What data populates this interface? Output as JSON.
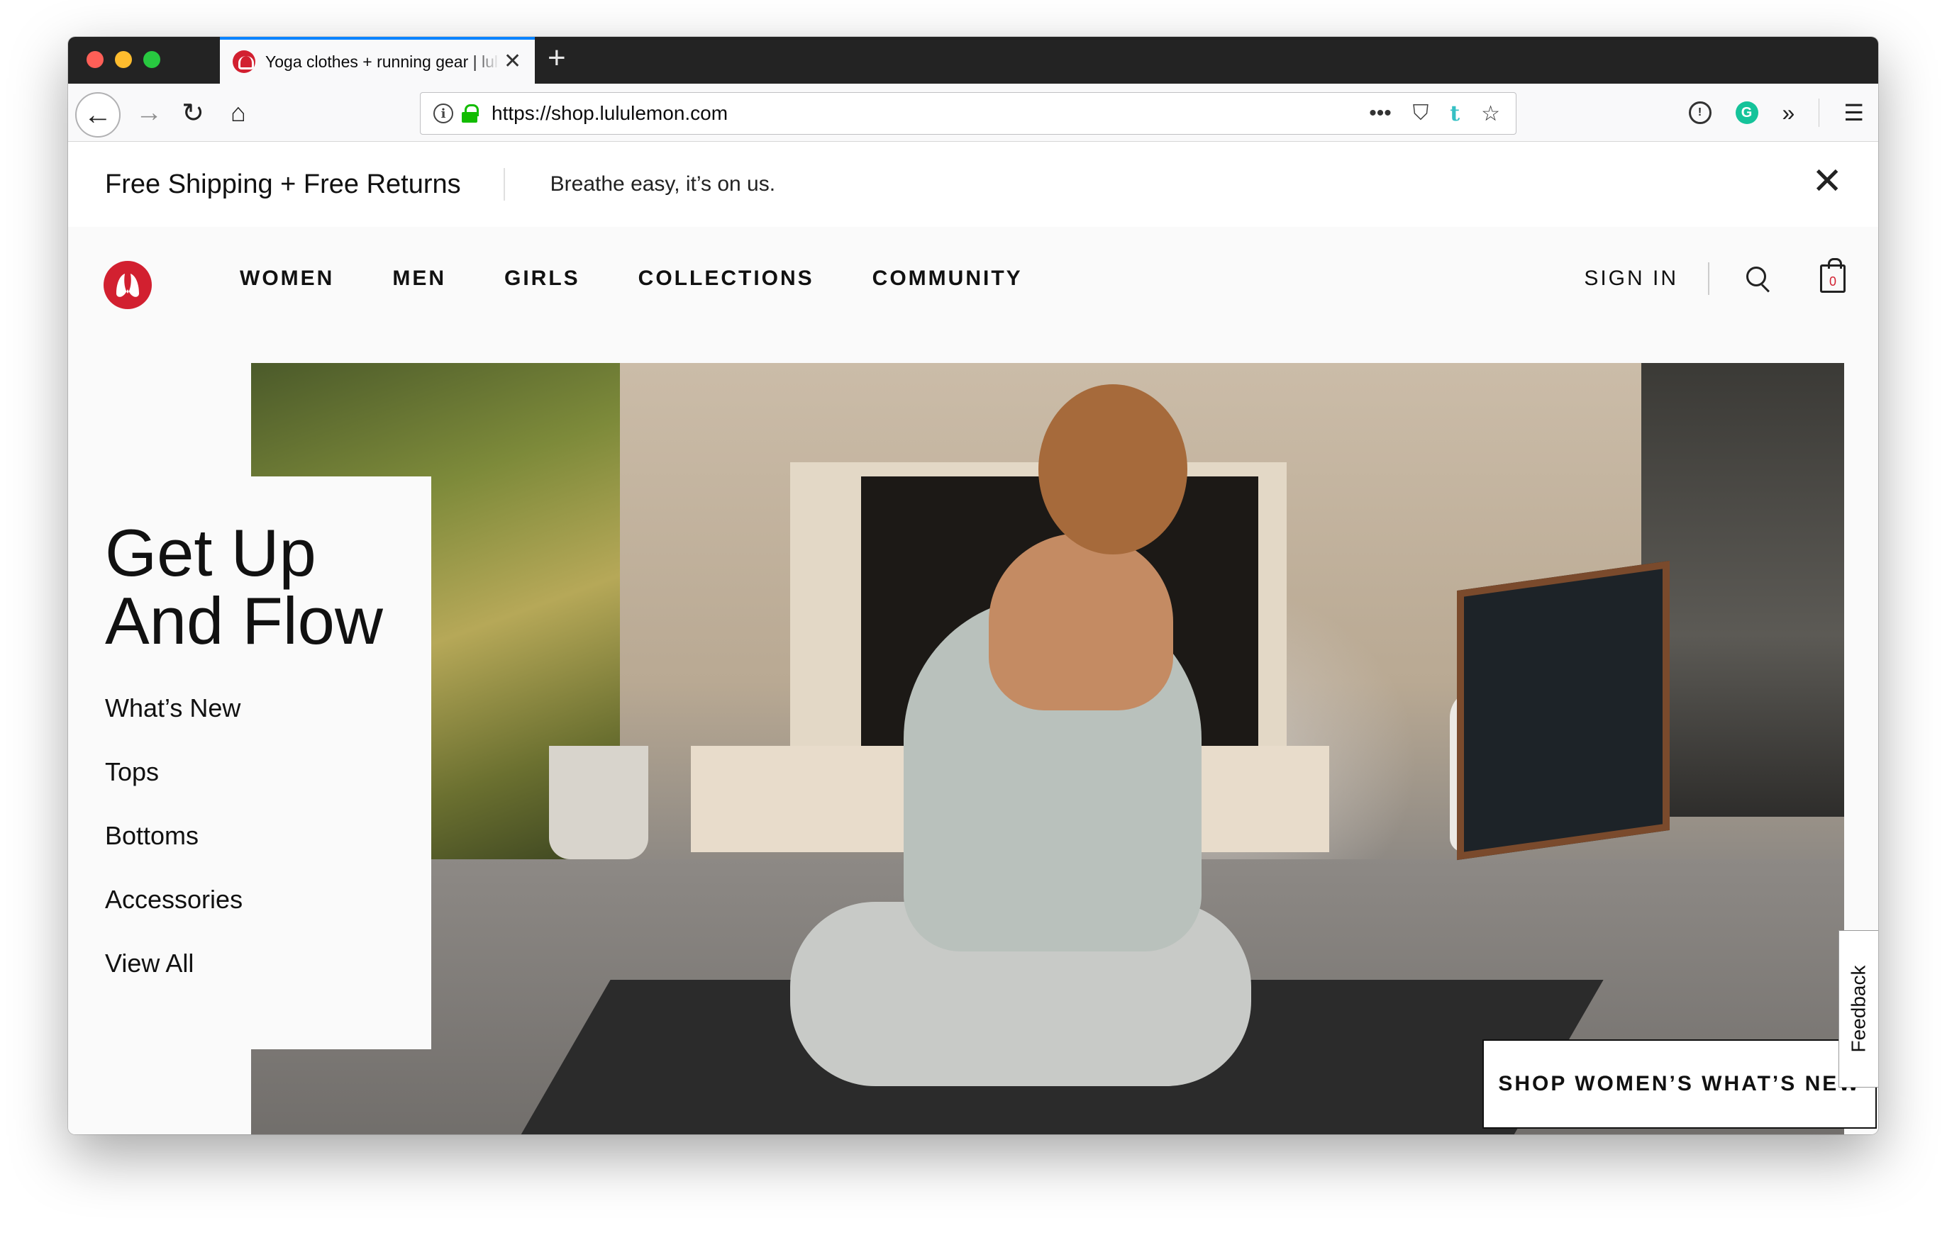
{
  "browser": {
    "tab_title": "Yoga clothes + running gear | lululemon",
    "tab_close": "✕",
    "new_tab": "+",
    "url": "https://shop.lululemon.com",
    "url_more": "•••"
  },
  "promo": {
    "main": "Free Shipping + Free Returns",
    "sub": "Breathe easy, it’s on us.",
    "close": "✕"
  },
  "nav": {
    "links": [
      "WOMEN",
      "MEN",
      "GIRLS",
      "COLLECTIONS",
      "COMMUNITY"
    ],
    "signin": "SIGN IN",
    "bag_count": "0"
  },
  "hero": {
    "title_line1": "Get Up",
    "title_line2": "And Flow",
    "links": [
      "What’s New",
      "Tops",
      "Bottoms",
      "Accessories",
      "View All"
    ],
    "cta": "SHOP WOMEN’S WHAT’S NEW"
  },
  "feedback": "Feedback",
  "colors": {
    "brand_red": "#d22030",
    "tab_accent": "#0a84ff"
  }
}
